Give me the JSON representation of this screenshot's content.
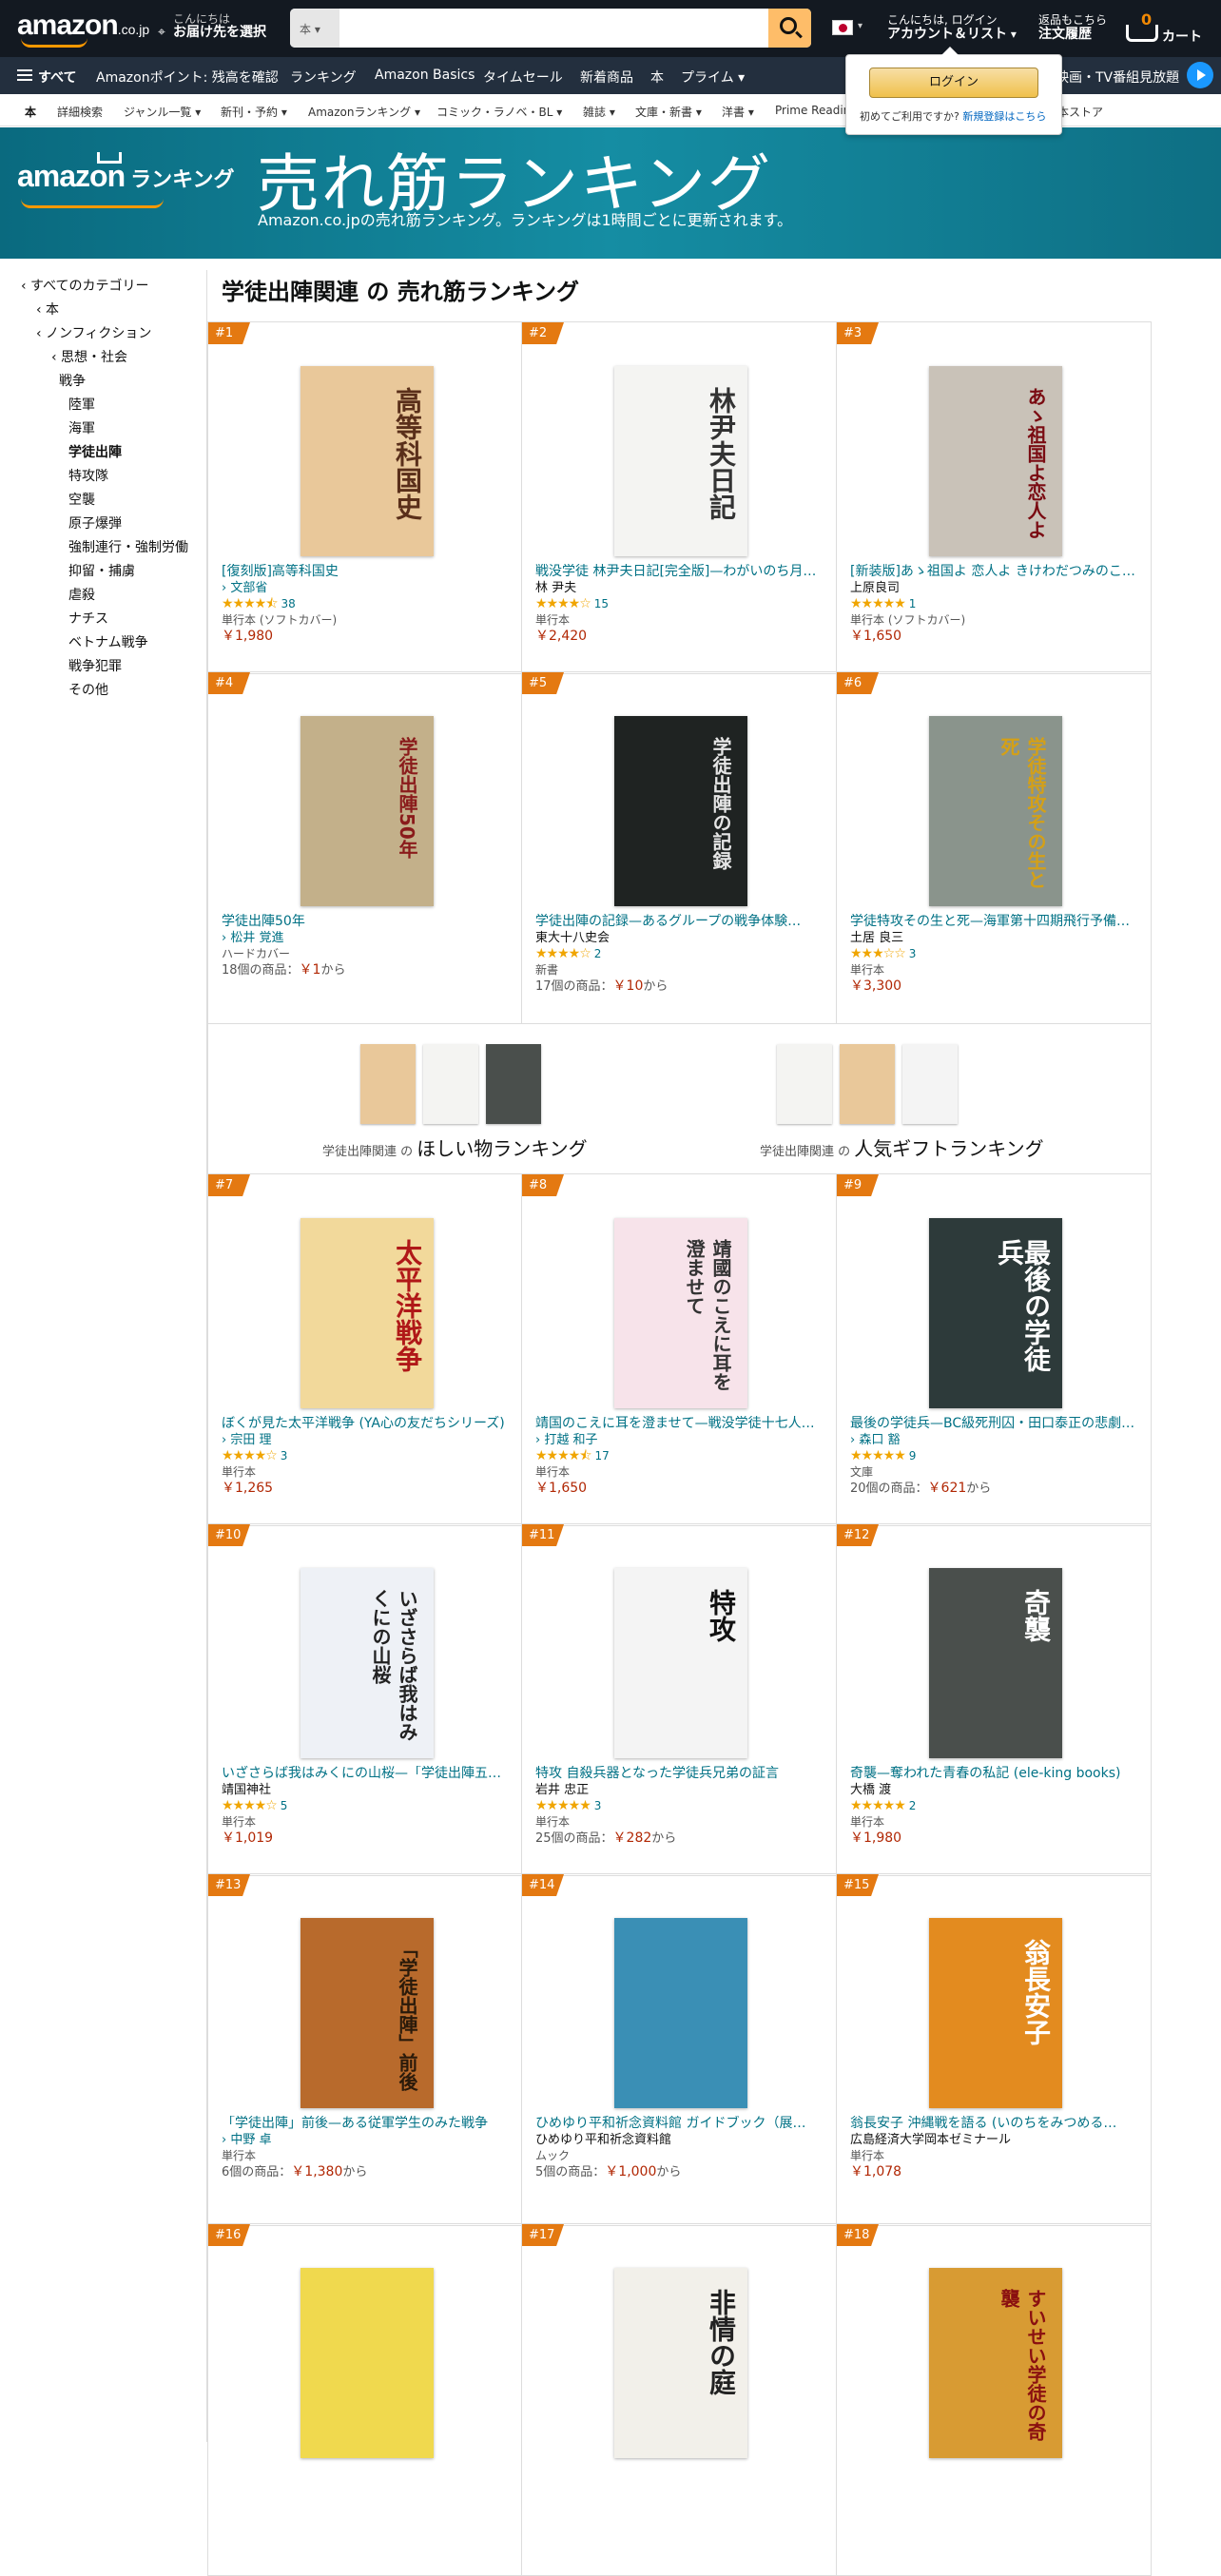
{
  "header": {
    "logo": "amazon",
    "logo_suffix": ".co.jp",
    "deliver_line1": "こんにちは",
    "deliver_line2": "お届け先を選択",
    "search_category": "本",
    "search_placeholder": "",
    "account_line1": "こんにちは, ログイン",
    "account_line2": "アカウント＆リスト",
    "orders_line1": "返品もこちら",
    "orders_line2": "注文履歴",
    "cart_count": "0",
    "cart_label": "カート",
    "accent": "#febd69"
  },
  "navbar": {
    "all_label": "すべて",
    "items": [
      "Amazonポイント: 残高を確認",
      "ランキング",
      "Amazon Basics",
      "タイムセール",
      "新着商品",
      "本",
      "プライム"
    ],
    "right_item": "映画・TV番組見放題"
  },
  "subnav": {
    "items": [
      "本",
      "詳細検索",
      "ジャンル一覧",
      "新刊・予約",
      "Amazonランキング",
      "コミック・ラノベ・BL",
      "雑誌",
      "文庫・新書",
      "洋書",
      "Prime Reading",
      "本ストア"
    ]
  },
  "signin_popup": {
    "button": "ログイン",
    "new_customer": "初めてご利用ですか?",
    "register_link": "新規登録はこちら"
  },
  "banner": {
    "logo_text": "amazon",
    "logo_label": "ランキング",
    "title": "売れ筋ランキング",
    "subtitle": "Amazon.co.jpの売れ筋ランキング。ランキングは1時間ごとに更新されます。",
    "color": "#0a6a7f"
  },
  "sidebar": {
    "items": [
      {
        "label": "‹ すべてのカテゴリー"
      },
      {
        "label": "‹ 本"
      },
      {
        "label": "‹ ノンフィクション"
      },
      {
        "label": "‹ 思想・社会"
      },
      {
        "label": "戦争"
      },
      {
        "label": "陸軍"
      },
      {
        "label": "海軍"
      },
      {
        "label": "学徒出陣",
        "selected": true
      },
      {
        "label": "特攻隊"
      },
      {
        "label": "空襲"
      },
      {
        "label": "原子爆弾"
      },
      {
        "label": "強制連行・強制労働"
      },
      {
        "label": "抑留・捕虜"
      },
      {
        "label": "虐殺"
      },
      {
        "label": "ナチス"
      },
      {
        "label": "ベトナム戦争"
      },
      {
        "label": "戦争犯罪"
      },
      {
        "label": "その他"
      }
    ]
  },
  "page_title": "学徒出陣関連 の 売れ筋ランキング",
  "products": [
    {
      "rank": "#1",
      "title": "[復刻版]高等科国史",
      "author": "文部省",
      "author_link": true,
      "stars": 4.5,
      "reviews": "38",
      "format": "単行本 (ソフトカバー)",
      "price": "￥1,980",
      "cover_bg": "#e9c89a",
      "cover_text": "高等科国史",
      "cover_fg": "#5a2f1a"
    },
    {
      "rank": "#2",
      "title": "戦没学徒 林尹夫日記[完全版]—わがいのち月…",
      "author": "林 尹夫",
      "author_link": false,
      "stars": 4,
      "reviews": "15",
      "format": "単行本",
      "price": "￥2,420",
      "cover_bg": "#f4f4f2",
      "cover_text": "林尹夫日記",
      "cover_fg": "#333"
    },
    {
      "rank": "#3",
      "title": "[新装版]あゝ祖国よ 恋人よ きけわだつみのこ…",
      "author": "上原良司",
      "author_link": false,
      "stars": 5,
      "reviews": "1",
      "format": "単行本 (ソフトカバー)",
      "price": "￥1,650",
      "cover_bg": "#c9c2b8",
      "cover_text": "あゝ祖国よ恋人よ",
      "cover_fg": "#7a0b12"
    },
    {
      "rank": "#4",
      "title": "学徒出陣50年",
      "author": "松井 覚進",
      "author_link": true,
      "stars": null,
      "reviews": "",
      "format": "ハードカバー",
      "offers": "18個の商品：",
      "offer_price": "￥1",
      "offer_suffix": "から",
      "cover_bg": "#c3b08a",
      "cover_text": "学徒出陣50年",
      "cover_fg": "#8a1b1b"
    },
    {
      "rank": "#5",
      "title": "学徒出陣の記録—あるグループの戦争体験…",
      "author": "東大十八史会",
      "author_link": false,
      "stars": 4,
      "reviews": "2",
      "format": "新書",
      "offers": "17個の商品：",
      "offer_price": "￥10",
      "offer_suffix": "から",
      "cover_bg": "#1f2322",
      "cover_text": "学徒出陣の記録",
      "cover_fg": "#e6e6e6"
    },
    {
      "rank": "#6",
      "title": "学徒特攻その生と死—海軍第十四期飛行予備…",
      "author": "土居 良三",
      "author_link": false,
      "stars": 3,
      "reviews": "3",
      "format": "単行本",
      "price": "￥3,300",
      "cover_bg": "#8a948c",
      "cover_text": "学徒特攻その生と死",
      "cover_fg": "#d4a017"
    },
    {
      "rank": "#7",
      "title": "ぼくが見た太平洋戦争 (YA心の友だちシリーズ)",
      "author": "宗田 理",
      "author_link": true,
      "stars": 4,
      "reviews": "3",
      "format": "単行本",
      "price": "￥1,265",
      "cover_bg": "#f2d99b",
      "cover_text": "太平洋戦争",
      "cover_fg": "#b01818"
    },
    {
      "rank": "#8",
      "title": "靖国のこえに耳を澄ませて—戦没学徒十七人…",
      "author": "打越 和子",
      "author_link": true,
      "stars": 4.5,
      "reviews": "17",
      "format": "単行本",
      "price": "￥1,650",
      "cover_bg": "#f7e3ea",
      "cover_text": "靖國のこえに耳を澄ませて",
      "cover_fg": "#333"
    },
    {
      "rank": "#9",
      "title": "最後の学徒兵—BC級死刑囚・田口泰正の悲劇…",
      "author": "森口 豁",
      "author_link": true,
      "stars": 5,
      "reviews": "9",
      "format": "文庫",
      "offers": "20個の商品：",
      "offer_price": "￥621",
      "offer_suffix": "から",
      "cover_bg": "#2d3a3a",
      "cover_text": "最後の学徒兵",
      "cover_fg": "#fff"
    },
    {
      "rank": "#10",
      "title": "いざさらば我はみくにの山桜—「学徒出陣五…",
      "author": "靖国神社",
      "author_link": false,
      "stars": 4,
      "reviews": "5",
      "format": "単行本",
      "price": "￥1,019",
      "cover_bg": "#eef1f6",
      "cover_text": "いざさらば我はみくにの山桜",
      "cover_fg": "#222"
    },
    {
      "rank": "#11",
      "title": "特攻 自殺兵器となった学徒兵兄弟の証言",
      "author": "岩井 忠正",
      "author_link": false,
      "stars": 5,
      "reviews": "3",
      "format": "単行本",
      "offers": "25個の商品：",
      "offer_price": "￥282",
      "offer_suffix": "から",
      "cover_bg": "#f4f4f4",
      "cover_text": "特攻",
      "cover_fg": "#111"
    },
    {
      "rank": "#12",
      "title": "奇襲—奪われた青春の私記 (ele-king books)",
      "author": "大橋 渡",
      "author_link": false,
      "stars": 5,
      "reviews": "2",
      "format": "単行本",
      "price": "￥1,980",
      "cover_bg": "#4a4f4c",
      "cover_text": "奇襲",
      "cover_fg": "#fff"
    },
    {
      "rank": "#13",
      "title": "「学徒出陣」前後—ある従軍学生のみた戦争",
      "author": "中野 卓",
      "author_link": true,
      "stars": null,
      "reviews": "",
      "format": "単行本",
      "offers": "6個の商品：",
      "offer_price": "￥1,380",
      "offer_suffix": "から",
      "cover_bg": "#b86a2c",
      "cover_text": "「学徒出陣」前後",
      "cover_fg": "#2a1a0a"
    },
    {
      "rank": "#14",
      "title": "ひめゆり平和祈念資料館 ガイドブック（展…",
      "author": "ひめゆり平和祈念資料館",
      "author_link": false,
      "stars": null,
      "reviews": "",
      "format": "ムック",
      "offers": "5個の商品：",
      "offer_price": "￥1,000",
      "offer_suffix": "から",
      "cover_bg": "#3a8fb5",
      "cover_text": "",
      "cover_fg": "#fff"
    },
    {
      "rank": "#15",
      "title": "翁長安子 沖縄戦を語る (いのちをみつめる…",
      "author": "広島経済大学岡本ゼミナール",
      "author_link": false,
      "stars": null,
      "reviews": "",
      "format": "単行本",
      "price": "￥1,078",
      "cover_bg": "#e38b1f",
      "cover_text": "翁長安子",
      "cover_fg": "#fff"
    },
    {
      "rank": "#16",
      "title": "",
      "author": "",
      "cover_bg": "#f0d94e",
      "cover_text": "",
      "cover_fg": "#222"
    },
    {
      "rank": "#17",
      "title": "",
      "author": "",
      "cover_bg": "#f2f0ea",
      "cover_text": "非情の庭",
      "cover_fg": "#222"
    },
    {
      "rank": "#18",
      "title": "",
      "author": "",
      "cover_bg": "#d89b33",
      "cover_text": "すいせい学徒の奇襲",
      "cover_fg": "#8a1010"
    }
  ],
  "promos": [
    {
      "prefix": "学徒出陣関連 の ",
      "label": "ほしい物ランキング",
      "thumb_colors": [
        "#e9c89a",
        "#f4f4f2",
        "#4a4f4c"
      ]
    },
    {
      "prefix": "学徒出陣関連 の ",
      "label": "人気ギフトランキング",
      "thumb_colors": [
        "#f4f4f2",
        "#e9c89a",
        "#f4f4f4"
      ]
    }
  ],
  "star_color": "#f0a500",
  "price_color": "#b12704",
  "link_color": "#007185",
  "badge_color": "#e47911"
}
